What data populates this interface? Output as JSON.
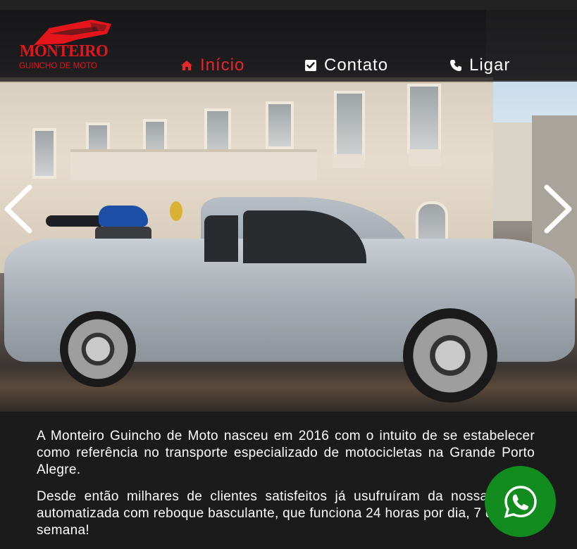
{
  "brand": {
    "name": "MONTEIRO",
    "tagline": "GUINCHO DE MOTO",
    "color": "#e4161c"
  },
  "nav": {
    "items": [
      {
        "label": "Início",
        "icon": "home-icon",
        "active": true
      },
      {
        "label": "Contato",
        "icon": "check-square-icon",
        "active": false
      },
      {
        "label": "Ligar",
        "icon": "phone-icon",
        "active": false
      }
    ],
    "active_color": "#e8262b"
  },
  "carousel": {
    "prev_icon": "chevron-left-icon",
    "next_icon": "chevron-right-icon"
  },
  "content": {
    "paragraphs": [
      "A Monteiro Guincho de Moto nasceu em 2016 com o intuito de se estabelecer como referência no transporte especializado de motocicletas na Grande Porto Alegre.",
      "Desde então milhares de clientes satisfeitos já usufruíram da nossa rampa automatizada com reboque basculante, que funciona 24 horas por dia, 7 dias por semana!"
    ]
  },
  "whatsapp": {
    "icon": "whatsapp-icon",
    "color": "#128c1e"
  }
}
